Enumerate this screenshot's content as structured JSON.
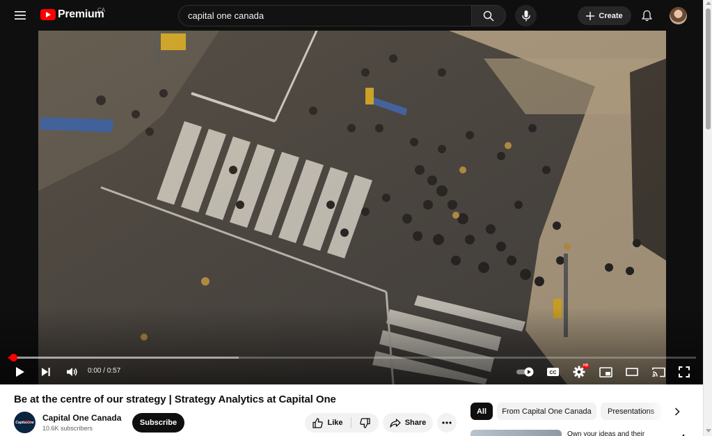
{
  "app": {
    "logo_text": "Premium",
    "logo_region": "CA"
  },
  "search": {
    "value": "capital one canada"
  },
  "masthead": {
    "create_label": "Create"
  },
  "player": {
    "time_display": "0:00 / 0:57",
    "progress_played_pct": 0.7,
    "progress_buffered_pct": 33.5,
    "quality_badge": "HD"
  },
  "video": {
    "title": "Be at the centre of our strategy | Strategy Analytics at Capital One",
    "channel_name": "Capital One Canada",
    "channel_avatar_text": "CapitalOne",
    "subscribers": "10.6K subscribers",
    "subscribe_label": "Subscribe",
    "like_label": "Like",
    "share_label": "Share"
  },
  "chips": {
    "all": "All",
    "from_channel": "From Capital One Canada",
    "presentations": "Presentations"
  },
  "recommendation": {
    "title": "Own your ideas and their"
  },
  "colors": {
    "brand_red": "#ff0000",
    "dark_bg": "#0f0f0f",
    "chip_bg": "#f2f2f2"
  }
}
